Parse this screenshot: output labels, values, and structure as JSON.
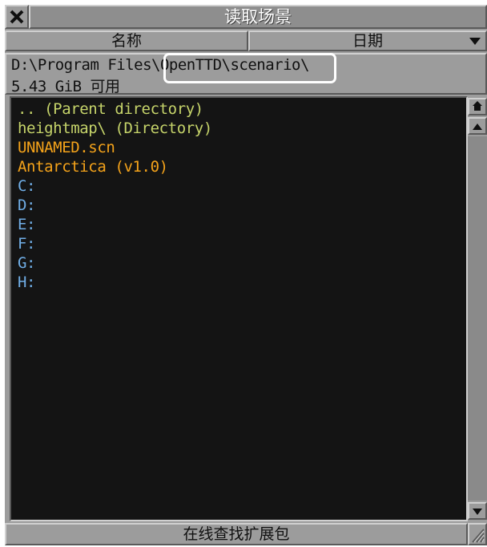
{
  "window": {
    "title": "读取场景"
  },
  "sort": {
    "name_label": "名称",
    "date_label": "日期"
  },
  "info": {
    "path": "D:\\Program Files\\OpenTTD\\scenario\\",
    "free_space": "5.43 GiB 可用"
  },
  "files": [
    {
      "label": ".. (Parent directory)",
      "kind": "parent"
    },
    {
      "label": "heightmap\\ (Directory)",
      "kind": "directory"
    },
    {
      "label": "UNNAMED.scn",
      "kind": "file"
    },
    {
      "label": "Antarctica (v1.0)",
      "kind": "file"
    },
    {
      "label": "C:",
      "kind": "drive"
    },
    {
      "label": "D:",
      "kind": "drive"
    },
    {
      "label": "E:",
      "kind": "drive"
    },
    {
      "label": "F:",
      "kind": "drive"
    },
    {
      "label": "G:",
      "kind": "drive"
    },
    {
      "label": "H:",
      "kind": "drive"
    }
  ],
  "footer": {
    "online_button_label": "在线查找扩展包"
  },
  "icons": {
    "close": "close-icon",
    "sort_direction": "triangle-down-icon",
    "scroll_home": "home-icon",
    "scroll_up": "arrow-up-icon",
    "scroll_down": "arrow-down-icon",
    "resize": "resize-grip-icon"
  },
  "colors": {
    "window_bg": "#9c9c9c",
    "list_bg": "#141414",
    "parent_dir_text": "#c6d46a",
    "directory_text": "#c6d46a",
    "file_text": "#f5a31a",
    "drive_text": "#70aee6",
    "highlight_outline": "#ffffff"
  }
}
